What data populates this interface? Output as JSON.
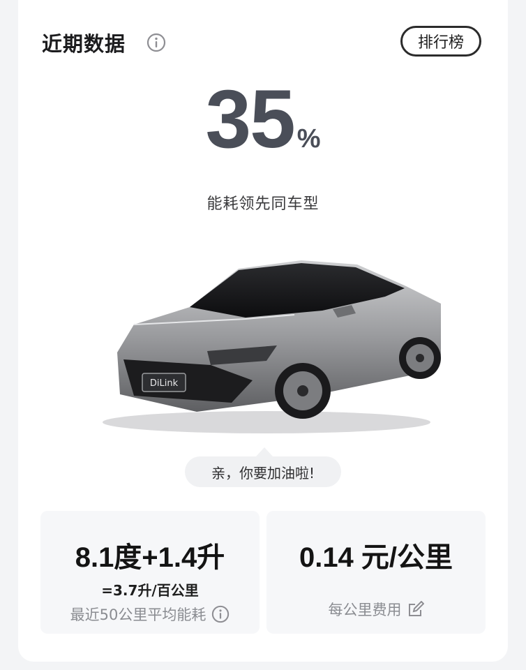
{
  "header": {
    "title": "近期数据",
    "info_icon": "info-icon",
    "rank_button": "排行榜"
  },
  "summary": {
    "percent_value": "35",
    "percent_unit": "%",
    "subtitle": "能耗领先同车型"
  },
  "bubble": {
    "text": "亲，你要加油啦!"
  },
  "stats": {
    "left": {
      "value": "8.1度+1.4升",
      "equivalent": "=3.7升/百公里",
      "caption": "最近50公里平均能耗"
    },
    "right": {
      "value": "0.14 元/公里",
      "caption": "每公里费用"
    }
  },
  "car_badge": "DiLink",
  "colors": {
    "accent_text": "#4a4e58",
    "card_bg": "#ffffff",
    "page_bg": "#f3f4f6",
    "stat_bg": "#f6f7f9"
  }
}
